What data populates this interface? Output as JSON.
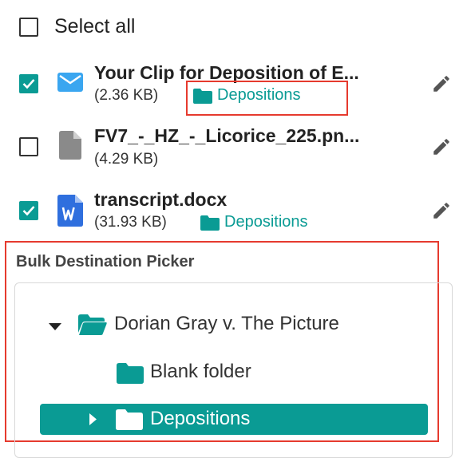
{
  "select_all": {
    "label": "Select all",
    "checked": false
  },
  "files": [
    {
      "name": "Your Clip for Deposition of E...",
      "size": "(2.36 KB)",
      "destination": "Depositions",
      "checked": true,
      "icon": "email-icon"
    },
    {
      "name": "FV7_-_HZ_-_Licorice_225.pn...",
      "size": "(4.29 KB)",
      "destination": "",
      "checked": false,
      "icon": "file-icon"
    },
    {
      "name": "transcript.docx",
      "size": "(31.93 KB)",
      "destination": "Depositions",
      "checked": true,
      "icon": "word-doc-icon"
    }
  ],
  "picker": {
    "title": "Bulk Destination Picker",
    "tree": [
      {
        "label": "Dorian Gray v. The Picture",
        "expanded": true
      },
      {
        "label": "Blank folder"
      },
      {
        "label": "Depositions",
        "selected": true
      }
    ]
  },
  "colors": {
    "accent": "#0a9b94",
    "highlight": "#e63a2e",
    "email_icon": "#3aa6f0",
    "word_icon": "#2f6fde"
  }
}
